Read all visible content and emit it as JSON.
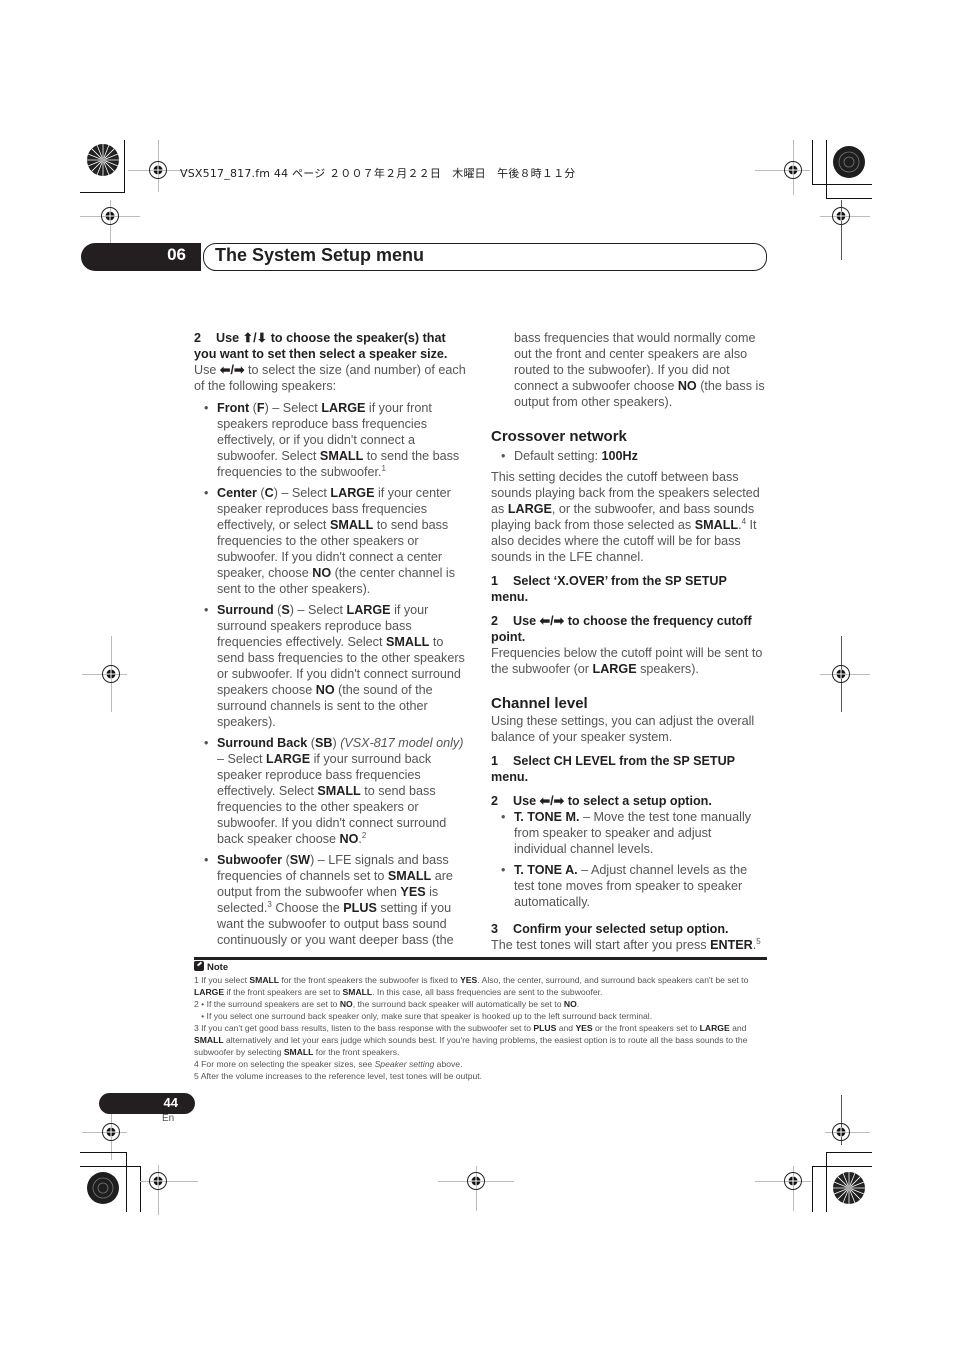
{
  "file_header": "VSX517_817.fm  44 ページ  ２００７年２月２２日　木曜日　午後８時１１分",
  "chapter": {
    "number": "06",
    "title": "The System Setup menu"
  },
  "left_column": {
    "step2": {
      "num": "2",
      "prefix": "Use ",
      "arrows": "⬆/⬇",
      "text": " to choose the speaker(s) that you want to set then select a speaker size."
    },
    "step2_body": {
      "prefix": "Use ",
      "arrows": "⬅/➡",
      "text": " to select the size (and number) of each of the following speakers:"
    },
    "speakers": [
      {
        "name": "Front",
        "abbr": "F",
        "parts": [
          {
            "t": " – Select "
          },
          {
            "b": "LARGE"
          },
          {
            "t": " if your front speakers reproduce bass frequencies effectively, or if you didn't connect a subwoofer. Select "
          },
          {
            "b": "SMALL"
          },
          {
            "t": " to send the bass frequencies to the subwoofer."
          }
        ],
        "footnote": "1"
      },
      {
        "name": "Center",
        "abbr": "C",
        "parts": [
          {
            "t": " – Select "
          },
          {
            "b": "LARGE"
          },
          {
            "t": " if your center speaker reproduces bass frequencies effectively, or select "
          },
          {
            "b": "SMALL"
          },
          {
            "t": " to send bass frequencies to the other speakers or subwoofer. If you didn't connect a center speaker, choose "
          },
          {
            "b": "NO"
          },
          {
            "t": " (the center channel is sent to the other speakers)."
          }
        ],
        "footnote": ""
      },
      {
        "name": "Surround",
        "abbr": "S",
        "parts": [
          {
            "t": " – Select "
          },
          {
            "b": "LARGE"
          },
          {
            "t": " if your surround speakers reproduce bass frequencies effectively. Select "
          },
          {
            "b": "SMALL"
          },
          {
            "t": " to send bass frequencies to the other speakers or subwoofer. If you didn't connect surround speakers choose "
          },
          {
            "b": "NO"
          },
          {
            "t": " (the sound of the surround channels is sent to the other speakers)."
          }
        ],
        "footnote": ""
      },
      {
        "name": "Surround Back",
        "abbr": "SB",
        "parts": [
          {
            "t": " "
          },
          {
            "i": "(VSX-817 model only)"
          },
          {
            "t": " – Select "
          },
          {
            "b": "LARGE"
          },
          {
            "t": " if your surround back speaker reproduce bass frequencies effectively. Select "
          },
          {
            "b": "SMALL"
          },
          {
            "t": " to send bass frequencies to the other speakers or subwoofer. If you didn't connect surround back speaker choose "
          },
          {
            "b": "NO"
          },
          {
            "t": "."
          }
        ],
        "footnote": "2"
      },
      {
        "name": "Subwoofer",
        "abbr": "SW",
        "parts": [
          {
            "t": " – LFE signals and bass frequencies of channels set to "
          },
          {
            "b": "SMALL"
          },
          {
            "t": " are output from the subwoofer when "
          },
          {
            "b": "YES"
          },
          {
            "t": " is selected."
          },
          {
            "sup": "3"
          },
          {
            "t": " Choose the "
          },
          {
            "b": "PLUS"
          },
          {
            "t": " setting if you want the subwoofer to output bass sound continuously or you want deeper bass (the"
          }
        ],
        "footnote": ""
      }
    ]
  },
  "right_column": {
    "continuation": [
      {
        "t": "bass frequencies that would normally come out the front and center speakers are also routed to the subwoofer). If you did not connect a subwoofer choose "
      },
      {
        "b": "NO"
      },
      {
        "t": " (the bass is output from other speakers)."
      }
    ],
    "crossover": {
      "heading": "Crossover network",
      "default_label": "Default setting: ",
      "default_value": "100Hz",
      "description": [
        {
          "t": "This setting decides the cutoff between bass sounds playing back from the speakers selected as "
        },
        {
          "b": "LARGE"
        },
        {
          "t": ", or the subwoofer, and bass sounds playing back from those selected as "
        },
        {
          "b": "SMALL"
        },
        {
          "t": "."
        },
        {
          "sup": "4"
        },
        {
          "t": " It also decides where the cutoff will be for bass sounds in the LFE channel."
        }
      ],
      "step1": {
        "num": "1",
        "text": "Select ‘X.OVER’ from the SP SETUP menu."
      },
      "step2": {
        "num": "2",
        "prefix": "Use ",
        "arrows": "⬅/➡",
        "text": " to choose the frequency cutoff point."
      },
      "step2_body": [
        {
          "t": "Frequencies below the cutoff point will be sent to the subwoofer (or "
        },
        {
          "b": "LARGE"
        },
        {
          "t": " speakers)."
        }
      ]
    },
    "channel_level": {
      "heading": "Channel level",
      "description": "Using these settings, you can adjust the overall balance of your speaker system.",
      "step1": {
        "num": "1",
        "text": "Select CH LEVEL from the SP SETUP menu."
      },
      "step2": {
        "num": "2",
        "prefix": "Use ",
        "arrows": "⬅/➡",
        "text": " to select a setup option."
      },
      "options": [
        {
          "name": "T. TONE M.",
          "text": " – Move the test tone manually from speaker to speaker and adjust individual channel levels."
        },
        {
          "name": "T. TONE A.",
          "text": " – Adjust channel levels as the test tone moves from speaker to speaker automatically."
        }
      ],
      "step3": {
        "num": "3",
        "text": "Confirm your selected setup option."
      },
      "step3_body": [
        {
          "t": "The test tones will start after you press "
        },
        {
          "b": "ENTER"
        },
        {
          "t": "."
        },
        {
          "sup": "5"
        }
      ]
    }
  },
  "notes": {
    "heading": "Note",
    "items": [
      [
        {
          "t": "1 If you select "
        },
        {
          "b": "SMALL"
        },
        {
          "t": " for the front speakers the subwoofer is fixed to "
        },
        {
          "b": "YES"
        },
        {
          "t": ". Also, the center, surround, and surround back speakers can't be set to "
        },
        {
          "b": "LARGE"
        },
        {
          "t": " if the front speakers are set to "
        },
        {
          "b": "SMALL"
        },
        {
          "t": ". In this case, all bass frequencies are sent to the subwoofer."
        }
      ],
      [
        {
          "t": "2 • If the surround speakers are set to "
        },
        {
          "b": "NO"
        },
        {
          "t": ", the surround back speaker will automatically be set to "
        },
        {
          "b": "NO"
        },
        {
          "t": "."
        }
      ],
      [
        {
          "t": "   • If you select one surround back speaker only, make sure that speaker is hooked up to the left surround back terminal."
        }
      ],
      [
        {
          "t": "3 If you can't get good bass results, listen to the bass response with the subwoofer set to "
        },
        {
          "b": "PLUS"
        },
        {
          "t": " and "
        },
        {
          "b": "YES"
        },
        {
          "t": " or the front speakers set to "
        },
        {
          "b": "LARGE"
        },
        {
          "t": " and "
        },
        {
          "b": "SMALL"
        },
        {
          "t": " alternatively and let your ears judge which sounds best. If you're having problems, the easiest option is to route all the bass sounds to the subwoofer by selecting "
        },
        {
          "b": "SMALL"
        },
        {
          "t": " for the front speakers."
        }
      ],
      [
        {
          "t": "4 For more on selecting the speaker sizes, see "
        },
        {
          "i": "Speaker setting"
        },
        {
          "t": " above."
        }
      ],
      [
        {
          "t": "5 After the volume increases to the reference level, test tones will be output."
        }
      ]
    ]
  },
  "footer": {
    "page_number": "44",
    "language": "En"
  }
}
